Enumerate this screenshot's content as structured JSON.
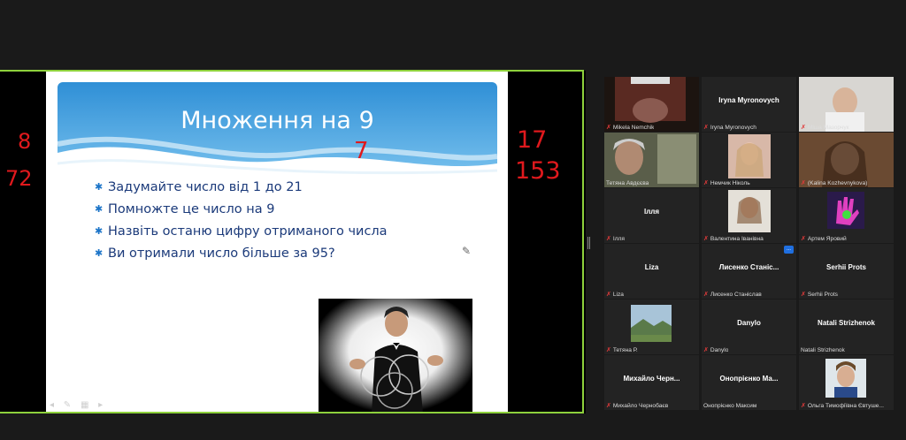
{
  "slide": {
    "title": "Множення на 9",
    "bullets": [
      "Задумайте число від 1   до 21",
      "Помножте це число на 9",
      "Назвіть останю цифру отриманого числа",
      "Ви отримали число більше за 95?"
    ]
  },
  "annotations": {
    "left_top": "8",
    "left_bottom": "72",
    "title_mark": "7",
    "right_top": "17",
    "right_bottom": "153"
  },
  "participants": [
    {
      "center": "",
      "label": "Mikela Nemchik",
      "muted": true,
      "video": true
    },
    {
      "center": "Iryna Myronovych",
      "label": "Iryna Myronovych",
      "muted": true,
      "video": false
    },
    {
      "center": "",
      "label": "Міша Мазорчук",
      "muted": true,
      "video": true
    },
    {
      "center": "",
      "label": "Тетяна Авдєєва",
      "muted": false,
      "video": true,
      "active": true
    },
    {
      "center": "",
      "label": "Немчик Ніколь",
      "muted": true,
      "video": true
    },
    {
      "center": "",
      "label": "(Kalina Kozhevnykova)",
      "muted": true,
      "video": true
    },
    {
      "center": "Ілля",
      "label": "Ілля",
      "muted": true,
      "video": false
    },
    {
      "center": "",
      "label": "Валентина Іванівна",
      "muted": true,
      "video": true
    },
    {
      "center": "",
      "label": "Артем Яровий",
      "muted": true,
      "video": true
    },
    {
      "center": "Liza",
      "label": "Liza",
      "muted": true,
      "video": false
    },
    {
      "center": "Лисенко  Станіс...",
      "label": "Лисенко Станіслав",
      "muted": true,
      "video": false,
      "more": "..."
    },
    {
      "center": "Serhii  Prots",
      "label": "Serhii  Prots",
      "muted": true,
      "video": false
    },
    {
      "center": "",
      "label": "Тетяна Р.",
      "muted": true,
      "video": true
    },
    {
      "center": "Danylo",
      "label": "Danylo",
      "muted": true,
      "video": false
    },
    {
      "center": "Natali Strizhenok",
      "label": "Natali Strizhenok",
      "muted": false,
      "video": false
    },
    {
      "center": "Михайло  Черн...",
      "label": "Михайло Чернобаєв",
      "muted": true,
      "video": false
    },
    {
      "center": "Онопрієнко  Ма...",
      "label": "Онопрієнко Максим",
      "muted": false,
      "video": false
    },
    {
      "center": "",
      "label": "Ольга Тимофіївна Євтуше...",
      "muted": true,
      "video": true
    }
  ],
  "icons": {
    "mic_muted": "mic-muted-icon",
    "pen": "pen-icon"
  },
  "colors": {
    "annotation": "#e0191d",
    "share_border": "#8ed13c",
    "active_speaker": "#c9d83a",
    "title_bar": "#3a9ad8"
  }
}
